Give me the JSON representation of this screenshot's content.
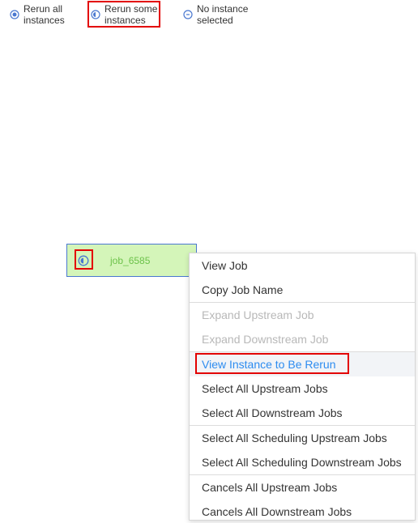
{
  "legend": {
    "rerun_all": {
      "label": "Rerun all\ninstances",
      "icon": "rerun-all-icon"
    },
    "rerun_some": {
      "label": "Rerun some\ninstances",
      "icon": "rerun-some-icon"
    },
    "no_instance": {
      "label": "No instance\nselected",
      "icon": "no-instance-icon"
    }
  },
  "job_node": {
    "name": "job_6585",
    "status_icon": "rerun-some-icon"
  },
  "context_menu": {
    "groups": [
      {
        "items": [
          {
            "label": "View Job",
            "state": "enabled"
          },
          {
            "label": "Copy Job Name",
            "state": "enabled"
          }
        ]
      },
      {
        "items": [
          {
            "label": "Expand Upstream Job",
            "state": "disabled"
          },
          {
            "label": "Expand Downstream Job",
            "state": "disabled"
          }
        ]
      },
      {
        "items": [
          {
            "label": "View Instance to Be Rerun",
            "state": "active"
          },
          {
            "label": "Select All Upstream Jobs",
            "state": "enabled"
          },
          {
            "label": "Select All Downstream Jobs",
            "state": "enabled"
          }
        ]
      },
      {
        "items": [
          {
            "label": "Select All Scheduling Upstream Jobs",
            "state": "enabled"
          },
          {
            "label": "Select All Scheduling Downstream Jobs",
            "state": "enabled"
          }
        ]
      },
      {
        "items": [
          {
            "label": "Cancels All Upstream Jobs",
            "state": "enabled"
          },
          {
            "label": "Cancels All Downstream Jobs",
            "state": "enabled"
          }
        ]
      }
    ]
  },
  "colors": {
    "node_fill": "#d4f5b9",
    "node_border": "#4a78d0",
    "job_name": "#6cc24a",
    "highlight": "#e30000",
    "menu_active_text": "#2d8cf0",
    "menu_disabled_text": "#b8b8b8"
  }
}
